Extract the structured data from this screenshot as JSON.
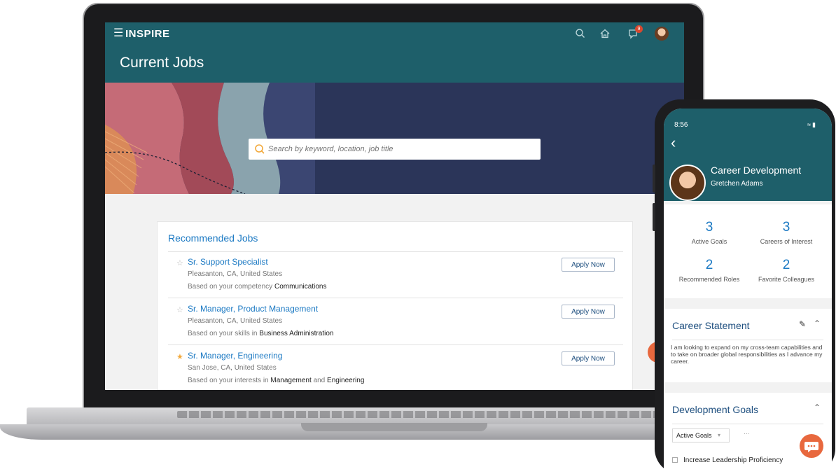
{
  "laptop": {
    "header": {
      "brand": "INSPIRE",
      "notification_count": "9"
    },
    "page_title": "Current Jobs",
    "search": {
      "placeholder": "Search by keyword, location, job title"
    },
    "recommended": {
      "title": "Recommended Jobs",
      "jobs": [
        {
          "title": "Sr. Support Specialist",
          "location": "Pleasanton, CA, United States",
          "basis_prefix": "Based on your competency",
          "basis_terms": "Communications",
          "starred": false,
          "apply_label": "Apply Now"
        },
        {
          "title": "Sr. Manager, Product Management",
          "location": "Pleasanton, CA, United States",
          "basis_prefix": "Based on your skills in",
          "basis_terms": "Business Administration",
          "starred": false,
          "apply_label": "Apply Now"
        },
        {
          "title": "Sr. Manager, Engineering",
          "location": "San Jose, CA, United States",
          "basis_prefix": "Based on your interests in",
          "basis_terms": "Management",
          "basis_join": "and",
          "basis_terms_2": "Engineering",
          "starred": true,
          "apply_label": "Apply Now"
        }
      ]
    },
    "icons": [
      "menu-icon",
      "search-icon",
      "home-icon",
      "notification-icon",
      "avatar"
    ]
  },
  "phone": {
    "time": "8:56",
    "title": "Career Development",
    "user": "Gretchen Adams",
    "stats": [
      {
        "value": "3",
        "label": "Active Goals"
      },
      {
        "value": "3",
        "label": "Careers of Interest"
      },
      {
        "value": "2",
        "label": "Recommended Roles"
      },
      {
        "value": "2",
        "label": "Favorite Colleagues"
      }
    ],
    "career_statement": {
      "title": "Career Statement",
      "text": "I am looking to expand on my cross-team capabilities and to take on broader global responsibilities as I advance my career."
    },
    "development_goals": {
      "title": "Development Goals",
      "filter": "Active Goals",
      "goal": "Increase Leadership Proficiency"
    }
  },
  "colors": {
    "header_teal": "#1e5f6a",
    "link_blue": "#1b79c3",
    "accent_orange": "#e8683e",
    "star_gold": "#f2a93b"
  }
}
